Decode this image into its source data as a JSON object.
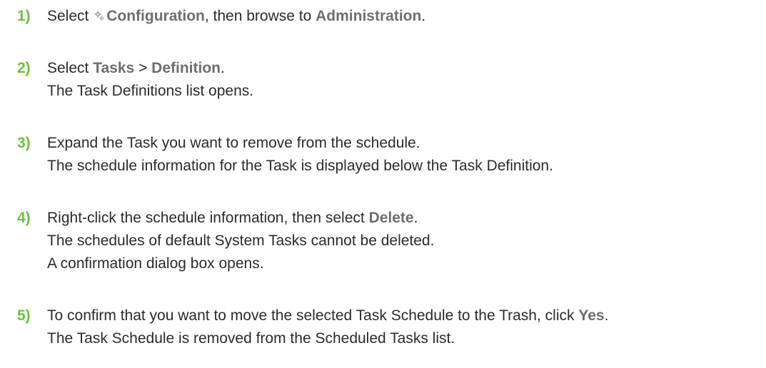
{
  "steps": [
    {
      "number": "1)",
      "select_prefix": "Select",
      "configuration": "Configuration",
      "middle": ", then browse to",
      "administration": "Administration",
      "end": "."
    },
    {
      "number": "2)",
      "select_prefix": "Select",
      "tasks": "Tasks",
      "sep": ">",
      "definition": "Definition",
      "end": ".",
      "note": "The Task Definitions list opens."
    },
    {
      "number": "3)",
      "line1": "Expand the Task you want to remove from the schedule.",
      "line2": "The schedule information for the Task is displayed below the Task Definition."
    },
    {
      "number": "4)",
      "prefix": "Right-click the schedule information, then select",
      "delete": "Delete",
      "end": ".",
      "line2": "The schedules of default System Tasks cannot be deleted.",
      "line3": "A confirmation dialog box opens."
    },
    {
      "number": "5)",
      "prefix": "To confirm that you want to move the selected Task Schedule to the Trash, click",
      "yes": "Yes",
      "end": ".",
      "line2": "The Task Schedule is removed from the Scheduled Tasks list."
    }
  ],
  "icons": {
    "configuration": "gear-icon"
  },
  "colors": {
    "step_number": "#6cbf3c",
    "ui_term": "#6e6e6e",
    "text": "#2b2b2b"
  }
}
